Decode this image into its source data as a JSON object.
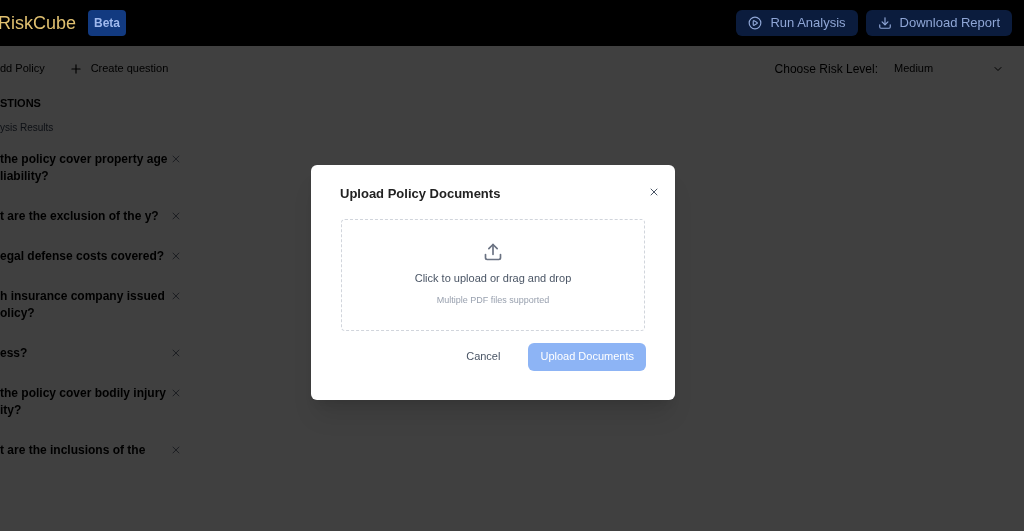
{
  "header": {
    "logo": "RiskCube",
    "badge": "Beta",
    "buttons": [
      {
        "label": "Run Analysis",
        "kind": "play"
      },
      {
        "label": "Download Report",
        "kind": "download"
      }
    ]
  },
  "toolbar": {
    "actions": [
      {
        "label": "dd Policy",
        "kind": "text"
      },
      {
        "label": "Create question",
        "kind": "plus"
      }
    ],
    "risk_label": "Choose Risk Level:",
    "risk_value": "Medium"
  },
  "sidebar": {
    "heading": "STIONS",
    "subheading": "ysis Results",
    "questions": [
      {
        "text": "the policy cover property age liability?"
      },
      {
        "text": "t are the exclusion of the y?"
      },
      {
        "text": "egal defense costs covered?"
      },
      {
        "text": "h insurance company issued olicy?"
      },
      {
        "text": "ess?"
      },
      {
        "text": "the policy cover bodily injury ity?"
      },
      {
        "text": "t are the inclusions of the"
      }
    ]
  },
  "dialog": {
    "title": "Upload Policy Documents",
    "dropzone": {
      "text": "Click to upload or drag and drop",
      "hint": "Multiple PDF files supported"
    },
    "cancel": "Cancel",
    "submit": {
      "label": "Upload Documents",
      "disabled": true
    }
  }
}
